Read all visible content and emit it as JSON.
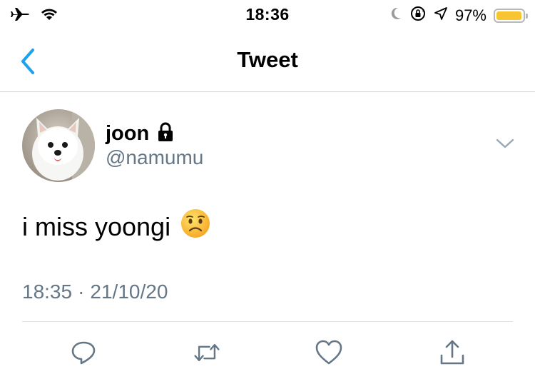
{
  "status_bar": {
    "time": "18:36",
    "battery_percent": "97%",
    "battery_level": 0.97,
    "battery_color": "#f7c531",
    "icons": [
      "airplane-icon",
      "wifi-icon",
      "moon-icon",
      "orientation-lock-icon",
      "location-arrow-icon",
      "battery-icon"
    ]
  },
  "nav": {
    "title": "Tweet",
    "back_icon": "chevron-left-icon",
    "accent_color": "#1da1f2"
  },
  "tweet": {
    "author": {
      "display_name": "joon",
      "handle": "@namumu",
      "protected_icon": "lock-icon"
    },
    "text": "i miss yoongi",
    "emoji": "worried-face-emoji",
    "time": "18:35",
    "separator": "·",
    "date": "21/10/20",
    "actions": [
      "reply-icon",
      "retweet-icon",
      "like-icon",
      "share-icon"
    ]
  }
}
